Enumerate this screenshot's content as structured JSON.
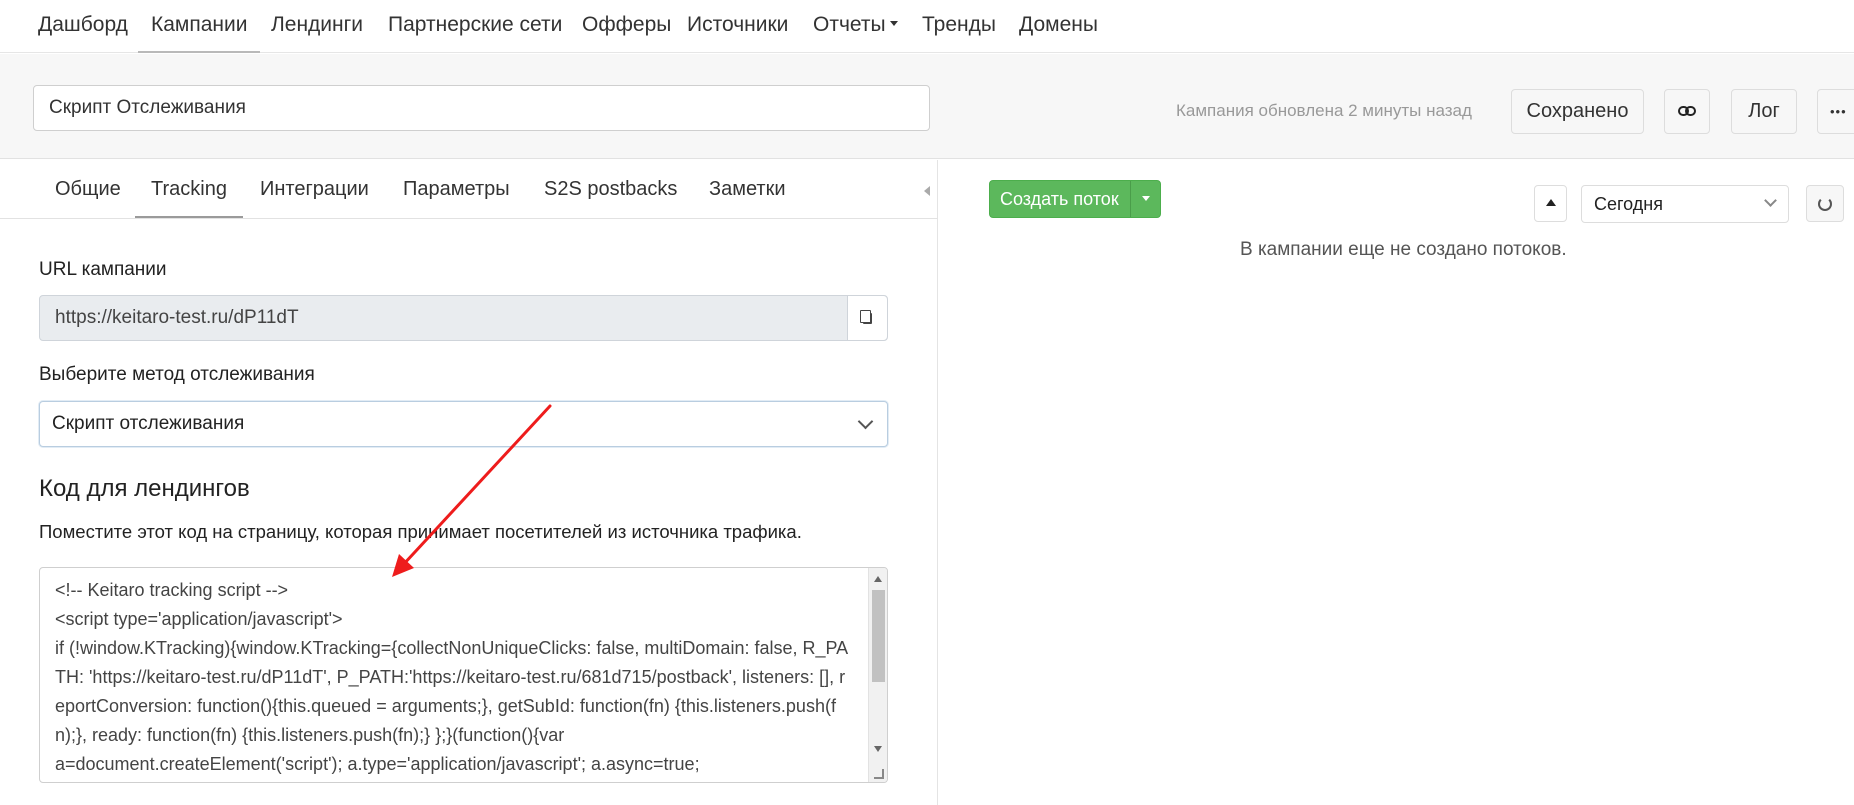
{
  "nav": {
    "items": [
      {
        "label": "Дашборд"
      },
      {
        "label": "Кампании"
      },
      {
        "label": "Лендинги"
      },
      {
        "label": "Партнерские сети"
      },
      {
        "label": "Офферы"
      },
      {
        "label": "Источники"
      },
      {
        "label": "Отчеты"
      },
      {
        "label": "Тренды"
      },
      {
        "label": "Домены"
      }
    ],
    "active": "Кампании"
  },
  "header": {
    "campaign_name": "Скрипт Отслеживания",
    "updated_text": "Кампания обновлена 2 минуты назад",
    "saved_label": "Сохранено",
    "link_icon": "link-icon",
    "log_label": "Лог",
    "more_label": "•••"
  },
  "tabs": {
    "items": [
      {
        "label": "Общие"
      },
      {
        "label": "Tracking"
      },
      {
        "label": "Интеграции"
      },
      {
        "label": "Параметры"
      },
      {
        "label": "S2S postbacks"
      },
      {
        "label": "Заметки"
      }
    ],
    "active": "Tracking"
  },
  "tracking": {
    "url_label": "URL кампании",
    "url_value": "https://keitaro-test.ru/dP11dT",
    "method_label": "Выберите метод отслеживания",
    "method_value": "Скрипт отслеживания",
    "code_title": "Код для лендингов",
    "code_description": "Поместите этот код на страницу, которая принимает посетителей из источника трафика.",
    "code": "<!-- Keitaro tracking script -->\n<script type='application/javascript'>\nif (!window.KTracking){window.KTracking={collectNonUniqueClicks: false, multiDomain: false, R_PATH: 'https://keitaro-test.ru/dP11dT', P_PATH:'https://keitaro-test.ru/681d715/postback', listeners: [], reportConversion: function(){this.queued = arguments;}, getSubId: function(fn) {this.listeners.push(fn);}, ready: function(fn) {this.listeners.push(fn);} };}(function(){var\na=document.createElement('script'); a.type='application/javascript'; a.async=true;"
  },
  "flows": {
    "create_label": "Создать поток",
    "period_value": "Сегодня",
    "empty_message": "В кампании еще не создано потоков."
  },
  "colors": {
    "primary_green": "#5cb85c",
    "annotation_arrow": "#ee1c1c"
  }
}
